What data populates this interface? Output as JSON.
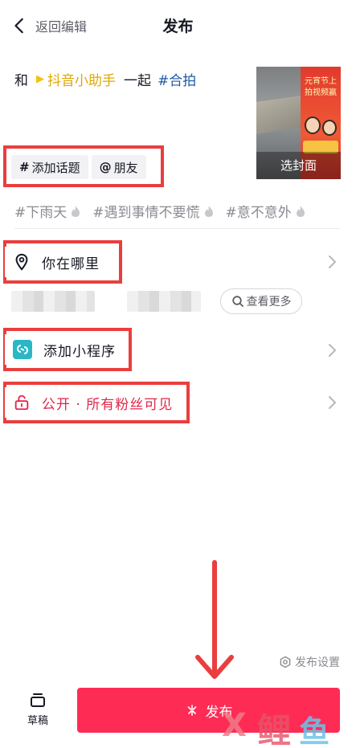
{
  "header": {
    "back_label": "返回编辑",
    "title": "发布"
  },
  "caption": {
    "prefix": "和",
    "mention": "抖音小助手",
    "with_text": "一起",
    "hashtag": "#合拍"
  },
  "cover": {
    "label": "选封面",
    "poster_text": "元宵节上拍视频赢"
  },
  "chips": {
    "topic": "添加话题",
    "topic_symbol": "#",
    "friend": "朋友",
    "friend_symbol": "@"
  },
  "trending": [
    "#下雨天",
    "#遇到事情不要慌",
    "#意不意外"
  ],
  "location": {
    "label": "你在哪里",
    "more_label": "查看更多"
  },
  "mini_program": {
    "label": "添加小程序"
  },
  "privacy": {
    "label": "公开 · 所有粉丝可见"
  },
  "settings": {
    "label": "发布设置"
  },
  "bottom": {
    "draft_label": "草稿",
    "publish_label": "发布"
  },
  "watermark": {
    "x": "X",
    "c1": "鲤",
    "c2": "鱼"
  },
  "colors": {
    "accent": "#fe2c55",
    "highlight": "#ea3e3e",
    "hashtag": "#1f5aa6",
    "mention": "#e0a800",
    "privacy": "#e0264a",
    "mini_icon": "#2ab7c6"
  }
}
